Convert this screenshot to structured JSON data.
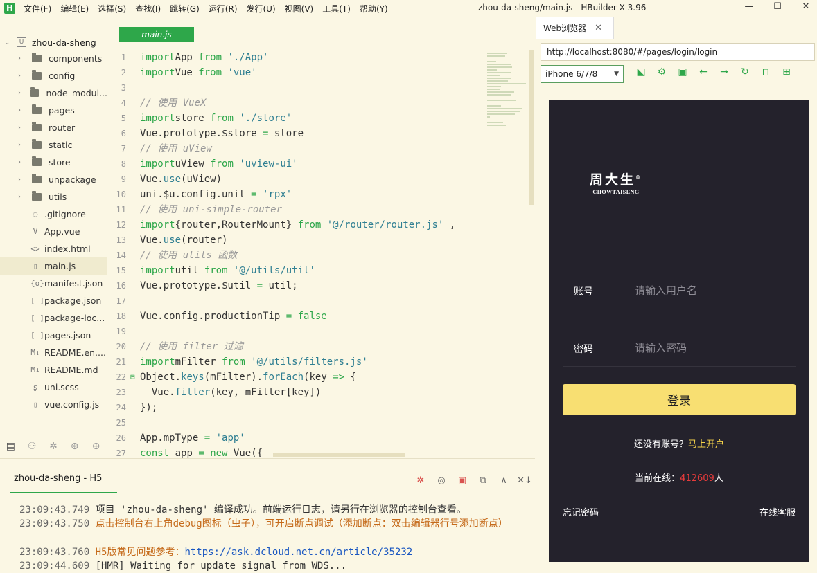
{
  "app": {
    "logo": "H",
    "window_title": "zhou-da-sheng/main.js - HBuilder X 3.96",
    "menus": [
      "文件(F)",
      "编辑(E)",
      "选择(S)",
      "查找(I)",
      "跳转(G)",
      "运行(R)",
      "发行(U)",
      "视图(V)",
      "工具(T)",
      "帮助(Y)"
    ],
    "controls": {
      "minimize": "—",
      "maximize": "☐",
      "close": "✕"
    }
  },
  "sidebar": {
    "project": "zhou-da-sheng",
    "folders": [
      "components",
      "config",
      "node_modul...",
      "pages",
      "router",
      "static",
      "store",
      "unpackage",
      "utils"
    ],
    "files": [
      {
        "icon": "◌",
        "name": ".gitignore"
      },
      {
        "icon": "V",
        "name": "App.vue"
      },
      {
        "icon": "<>",
        "name": "index.html"
      },
      {
        "icon": "▯",
        "name": "main.js",
        "selected": true
      },
      {
        "icon": "{o}",
        "name": "manifest.json"
      },
      {
        "icon": "[ ]",
        "name": "package.json"
      },
      {
        "icon": "[ ]",
        "name": "package-loc..."
      },
      {
        "icon": "[ ]",
        "name": "pages.json"
      },
      {
        "icon": "M↓",
        "name": "README.en...."
      },
      {
        "icon": "M↓",
        "name": "README.md"
      },
      {
        "icon": "ʂ",
        "name": "uni.scss"
      },
      {
        "icon": "▯",
        "name": "vue.config.js"
      }
    ],
    "footer_icons": [
      "files-icon",
      "plugin-icon",
      "debug-icon",
      "search-icon",
      "globe-icon"
    ]
  },
  "editor": {
    "tab": "main.js",
    "lines": [
      {
        "n": "1",
        "fold": "",
        "tokens": [
          [
            "kw",
            "import"
          ],
          [
            "",
            "App "
          ],
          [
            "kw",
            "from"
          ],
          [
            "",
            " "
          ],
          [
            "str",
            "'./App'"
          ]
        ]
      },
      {
        "n": "2",
        "fold": "",
        "tokens": [
          [
            "kw",
            "import"
          ],
          [
            "",
            "Vue "
          ],
          [
            "kw",
            "from"
          ],
          [
            "",
            " "
          ],
          [
            "str",
            "'vue'"
          ]
        ]
      },
      {
        "n": "3",
        "fold": "",
        "tokens": []
      },
      {
        "n": "4",
        "fold": "",
        "tokens": [
          [
            "cm",
            "// 使用 VueX"
          ]
        ]
      },
      {
        "n": "5",
        "fold": "",
        "tokens": [
          [
            "kw",
            "import"
          ],
          [
            "",
            "store "
          ],
          [
            "kw",
            "from"
          ],
          [
            "",
            " "
          ],
          [
            "str",
            "'./store'"
          ]
        ]
      },
      {
        "n": "6",
        "fold": "",
        "tokens": [
          [
            "",
            "Vue.prototype.$store "
          ],
          [
            "kw",
            "="
          ],
          [
            "",
            " store"
          ]
        ]
      },
      {
        "n": "7",
        "fold": "",
        "tokens": [
          [
            "cm",
            "// 使用 uView"
          ]
        ]
      },
      {
        "n": "8",
        "fold": "",
        "tokens": [
          [
            "kw",
            "import"
          ],
          [
            "",
            "uView "
          ],
          [
            "kw",
            "from"
          ],
          [
            "",
            " "
          ],
          [
            "str",
            "'uview-ui'"
          ]
        ]
      },
      {
        "n": "9",
        "fold": "",
        "tokens": [
          [
            "",
            "Vue."
          ],
          [
            "fn",
            "use"
          ],
          [
            "",
            "(uView)"
          ]
        ]
      },
      {
        "n": "10",
        "fold": "",
        "tokens": [
          [
            "",
            "uni.$u.config.unit "
          ],
          [
            "kw",
            "="
          ],
          [
            "",
            " "
          ],
          [
            "str",
            "'rpx'"
          ]
        ]
      },
      {
        "n": "11",
        "fold": "",
        "tokens": [
          [
            "cm",
            "// 使用 uni-simple-router"
          ]
        ]
      },
      {
        "n": "12",
        "fold": "",
        "tokens": [
          [
            "kw",
            "import"
          ],
          [
            "",
            "{router,RouterMount} "
          ],
          [
            "kw",
            "from"
          ],
          [
            "",
            " "
          ],
          [
            "str",
            "'@/router/router.js'"
          ],
          [
            "",
            " ,"
          ]
        ]
      },
      {
        "n": "13",
        "fold": "",
        "tokens": [
          [
            "",
            "Vue."
          ],
          [
            "fn",
            "use"
          ],
          [
            "",
            "(router)"
          ]
        ]
      },
      {
        "n": "14",
        "fold": "",
        "tokens": [
          [
            "cm",
            "// 使用 utils 函数"
          ]
        ]
      },
      {
        "n": "15",
        "fold": "",
        "tokens": [
          [
            "kw",
            "import"
          ],
          [
            "",
            "util "
          ],
          [
            "kw",
            "from"
          ],
          [
            "",
            " "
          ],
          [
            "str",
            "'@/utils/util'"
          ]
        ]
      },
      {
        "n": "16",
        "fold": "",
        "tokens": [
          [
            "",
            "Vue.prototype.$util "
          ],
          [
            "kw",
            "="
          ],
          [
            "",
            " util;"
          ]
        ]
      },
      {
        "n": "17",
        "fold": "",
        "tokens": []
      },
      {
        "n": "18",
        "fold": "",
        "tokens": [
          [
            "",
            "Vue.config.productionTip "
          ],
          [
            "kw",
            "="
          ],
          [
            "",
            " "
          ],
          [
            "kw",
            "false"
          ]
        ]
      },
      {
        "n": "19",
        "fold": "",
        "tokens": []
      },
      {
        "n": "20",
        "fold": "",
        "tokens": [
          [
            "cm",
            "// 使用 filter 过滤"
          ]
        ]
      },
      {
        "n": "21",
        "fold": "",
        "tokens": [
          [
            "kw",
            "import"
          ],
          [
            "",
            "mFilter "
          ],
          [
            "kw",
            "from"
          ],
          [
            "",
            " "
          ],
          [
            "str",
            "'@/utils/filters.js'"
          ]
        ]
      },
      {
        "n": "22",
        "fold": "⊟",
        "tokens": [
          [
            "",
            "Object."
          ],
          [
            "fn",
            "keys"
          ],
          [
            "",
            "(mFilter)."
          ],
          [
            "fn",
            "forEach"
          ],
          [
            "",
            "(key "
          ],
          [
            "kw",
            "=>"
          ],
          [
            "",
            " {"
          ]
        ]
      },
      {
        "n": "23",
        "fold": "",
        "tokens": [
          [
            "",
            "  Vue."
          ],
          [
            "fn",
            "filter"
          ],
          [
            "",
            "(key, mFilter[key])"
          ]
        ]
      },
      {
        "n": "24",
        "fold": "",
        "tokens": [
          [
            "",
            "});"
          ]
        ]
      },
      {
        "n": "25",
        "fold": "",
        "tokens": []
      },
      {
        "n": "26",
        "fold": "",
        "tokens": [
          [
            "",
            "App.mpType "
          ],
          [
            "kw",
            "="
          ],
          [
            "",
            " "
          ],
          [
            "str",
            "'app'"
          ]
        ]
      },
      {
        "n": "27",
        "fold": "",
        "tokens": [
          [
            "kw",
            "const"
          ],
          [
            "",
            " app "
          ],
          [
            "kw",
            "="
          ],
          [
            "",
            " "
          ],
          [
            "kw",
            "new"
          ],
          [
            "",
            " Vue({"
          ]
        ]
      }
    ]
  },
  "console": {
    "tab": "zhou-da-sheng - H5",
    "icons": [
      "debug-icon",
      "run-icon",
      "stop-icon",
      "open-external-icon",
      "collapse-icon",
      "clear-icon"
    ],
    "logs": [
      {
        "ts": "23:09:43.749",
        "text": "项目 'zhou-da-sheng' 编译成功。前端运行日志，请另行在浏览器的控制台查看。",
        "color": "normal"
      },
      {
        "ts": "23:09:43.750",
        "text": "点击控制台右上角debug图标（虫子），可开启断点调试（添加断点：双击编辑器行号添加断点）",
        "color": "orange"
      },
      {
        "ts": "23:09:43.760",
        "text": "H5版常见问题参考：",
        "link": "https://ask.dcloud.net.cn/article/35232",
        "color": "orange"
      },
      {
        "ts": "23:09:44.609",
        "text": "[HMR] Waiting for update signal from WDS...",
        "color": "normal"
      }
    ]
  },
  "browser": {
    "tab": "Web浏览器",
    "tab_close": "✕",
    "url": "http://localhost:8080/#/pages/login/login",
    "device": "iPhone 6/7/8",
    "tools": [
      "screenshot-icon",
      "settings-icon",
      "console-icon",
      "back-icon",
      "forward-icon",
      "reload-icon",
      "lock-icon",
      "qrcode-icon"
    ]
  },
  "login": {
    "logo_cn": "周大生",
    "logo_mark": "®",
    "logo_en": "CHOWTAISENG",
    "account_label": "账号",
    "account_placeholder": "请输入用户名",
    "password_label": "密码",
    "password_placeholder": "请输入密码",
    "login_button": "登录",
    "no_account": "还没有账号？",
    "register_link": "马上开户",
    "online_label": "当前在线：",
    "online_count": "412609",
    "online_unit": "人",
    "forgot": "忘记密码",
    "service": "在线客服",
    "colors": {
      "background": "#24222c",
      "button": "#f8df72",
      "link": "#f5d34a",
      "count": "#e53b3b"
    }
  }
}
